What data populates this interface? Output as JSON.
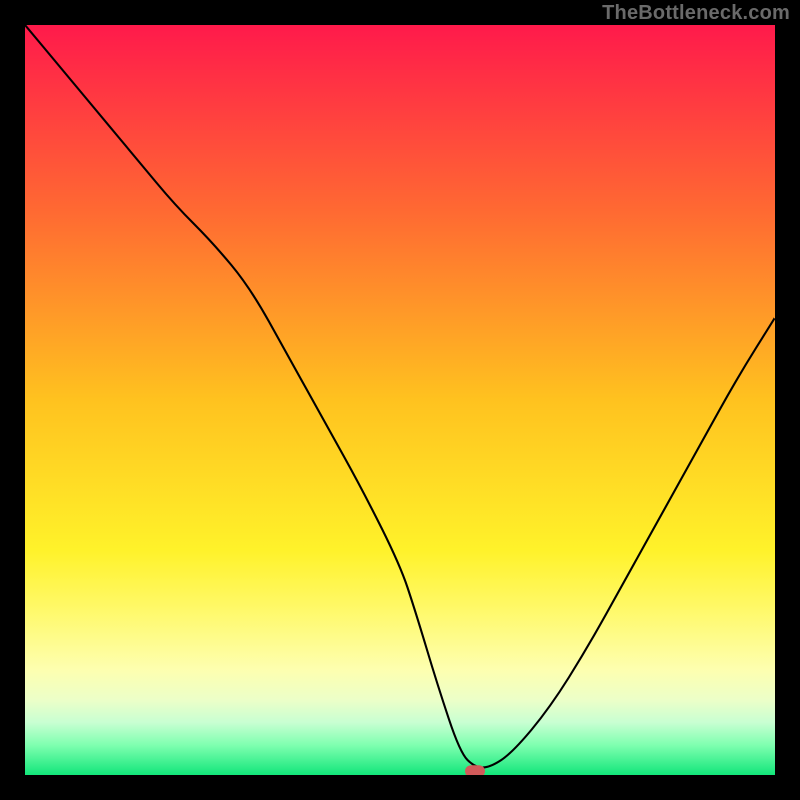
{
  "watermark": "TheBottleneck.com",
  "chart_data": {
    "type": "line",
    "title": "",
    "xlabel": "",
    "ylabel": "",
    "xlim": [
      0,
      100
    ],
    "ylim": [
      0,
      100
    ],
    "grid": false,
    "legend": false,
    "background_gradient": {
      "stops": [
        {
          "y_pct": 0,
          "color": "#ff1a4b"
        },
        {
          "y_pct": 25,
          "color": "#ff6a32"
        },
        {
          "y_pct": 50,
          "color": "#ffc21f"
        },
        {
          "y_pct": 70,
          "color": "#fff22a"
        },
        {
          "y_pct": 78,
          "color": "#fff96a"
        },
        {
          "y_pct": 86,
          "color": "#fdffb0"
        },
        {
          "y_pct": 90,
          "color": "#ecffc8"
        },
        {
          "y_pct": 93,
          "color": "#c8ffd2"
        },
        {
          "y_pct": 96,
          "color": "#7fffb0"
        },
        {
          "y_pct": 100,
          "color": "#12e67a"
        }
      ]
    },
    "series": [
      {
        "name": "bottleneck-curve",
        "color": "#000000",
        "width": 2.1,
        "x": [
          0,
          5,
          10,
          15,
          20,
          25,
          30,
          35,
          40,
          45,
          50,
          52,
          55,
          58,
          60,
          62,
          65,
          70,
          75,
          80,
          85,
          90,
          95,
          100
        ],
        "y": [
          100,
          94,
          88,
          82,
          76,
          71,
          65,
          56,
          47,
          38,
          28,
          22,
          12,
          3,
          1,
          1,
          3,
          9,
          17,
          26,
          35,
          44,
          53,
          61
        ]
      }
    ],
    "marker": {
      "name": "optimal-point",
      "x": 60,
      "y": 0.5,
      "color": "#d15a5a",
      "rx": 10,
      "ry": 6
    }
  }
}
